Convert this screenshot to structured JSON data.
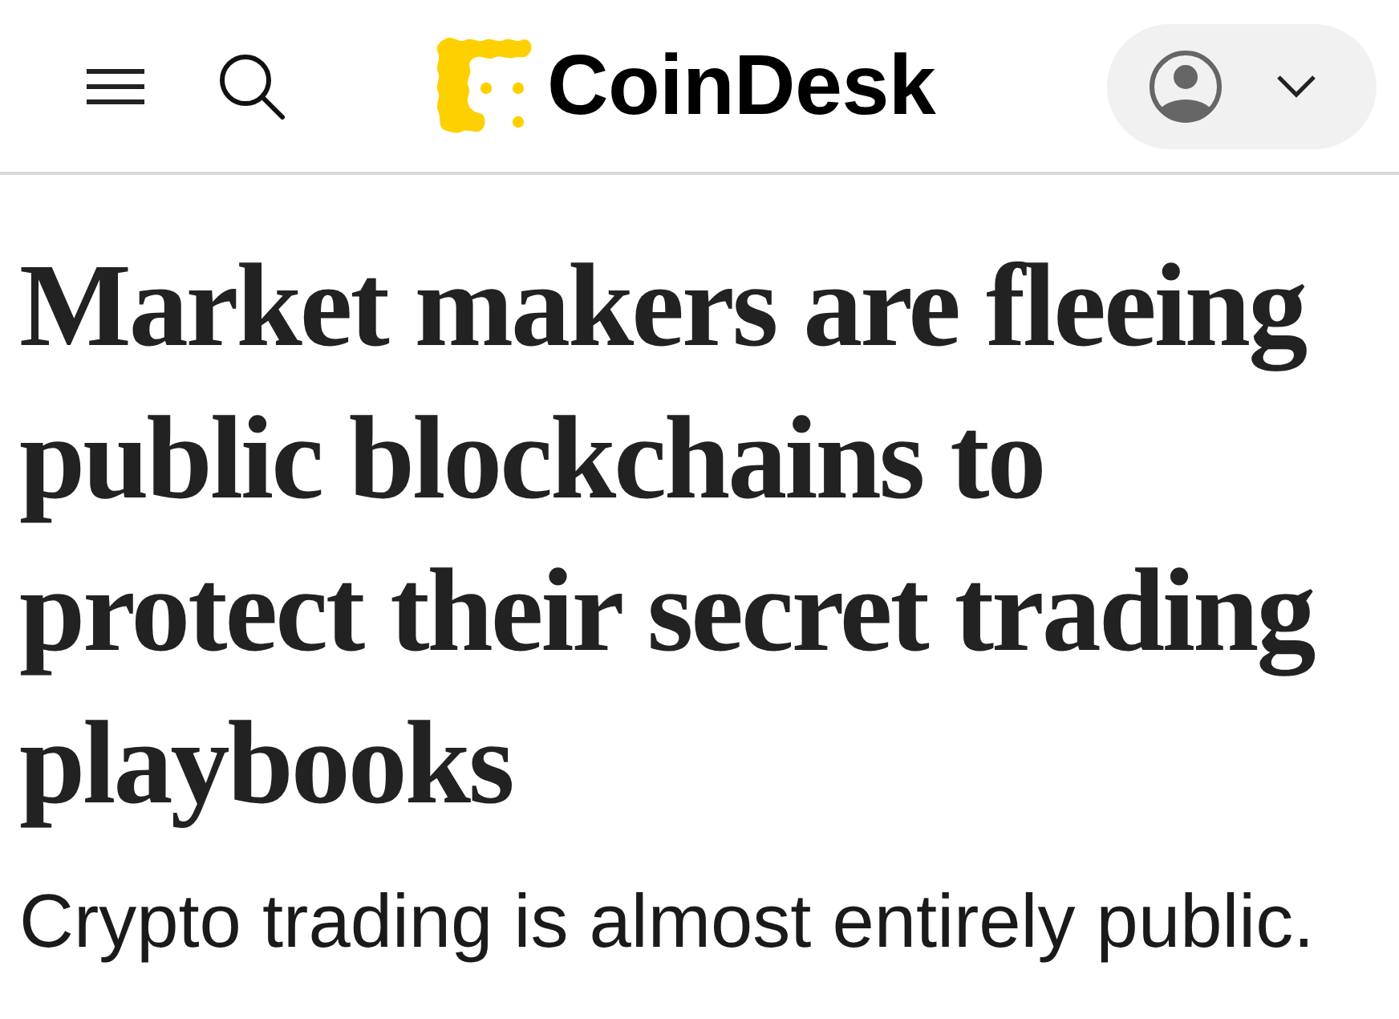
{
  "header": {
    "logo": {
      "text": "CoinDesk"
    }
  },
  "article": {
    "headline": "Market makers are fleeing public blockchains to protect their secret trading playbooks",
    "subheadline": "Crypto trading is almost entirely public."
  }
}
